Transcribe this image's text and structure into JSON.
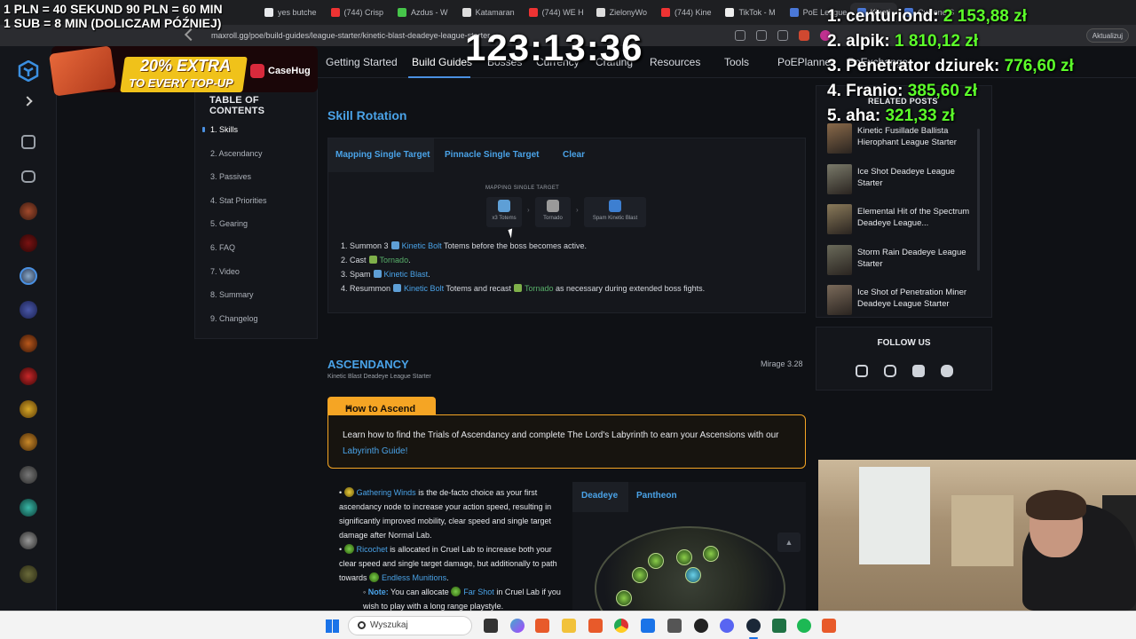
{
  "browser": {
    "tabs": [
      {
        "label": "yes butche",
        "color": "#e8eaed"
      },
      {
        "label": "(744) Crisp",
        "color": "#e33"
      },
      {
        "label": "Azdus - W",
        "color": "#46c54a"
      },
      {
        "label": "Katamaran",
        "color": "#ddd"
      },
      {
        "label": "(744) WE H",
        "color": "#e33"
      },
      {
        "label": "ZielonyWo",
        "color": "#ddd"
      },
      {
        "label": "(744) Kine",
        "color": "#e33"
      },
      {
        "label": "TikTok - M",
        "color": "#eee"
      },
      {
        "label": "PoE League",
        "color": "#4a78d8"
      },
      {
        "label": "Kineti",
        "color": "#4a78d8"
      },
      {
        "label": "Cyclone S",
        "color": "#4a78d8"
      }
    ],
    "url": "maxroll.gg/poe/build-guides/league-starter/kinetic-blast-deadeye-league-starter",
    "update_label": "Aktualizuj"
  },
  "nav": {
    "items": [
      "Getting Started",
      "Build Guides",
      "Bosses",
      "Currency",
      "Crafting",
      "Resources",
      "Tools",
      "PoEPlanner",
      "PoExchange"
    ],
    "active": "Build Guides"
  },
  "toc": {
    "title": "TABLE OF CONTENTS",
    "items": [
      "1. Skills",
      "2. Ascendancy",
      "3. Passives",
      "4. Stat Priorities",
      "5. Gearing",
      "6. FAQ",
      "7. Video",
      "8. Summary",
      "9. Changelog"
    ]
  },
  "skill_rotation": {
    "title": "Skill Rotation",
    "tabs": [
      "Mapping Single Target",
      "Pinnacle Single Target",
      "Clear"
    ],
    "sequence_label": "MAPPING SINGLE TARGET",
    "sequence": [
      {
        "caption": "x3 Totems",
        "icon": "kinetic-bolt-icon",
        "color": "#5e9fd6"
      },
      {
        "caption": "Tornado",
        "icon": "tornado-icon",
        "color": "#9a9a9a"
      },
      {
        "caption": "Spam Kinetic Blast",
        "icon": "kinetic-blast-icon",
        "color": "#3d7fd1"
      }
    ],
    "steps": [
      {
        "num": "1.",
        "pre": "Summon 3",
        "skill": "Kinetic Bolt",
        "post": "Totems before the boss becomes active."
      },
      {
        "num": "2.",
        "pre": "Cast",
        "skill": "Tornado",
        "post": "."
      },
      {
        "num": "3.",
        "pre": "Spam",
        "skill": "Kinetic Blast",
        "post": "."
      },
      {
        "num": "4.",
        "pre": "Resummon",
        "skill": "Kinetic Bolt",
        "mid": "Totems and recast",
        "skill2": "Tornado",
        "post": "as necessary during extended boss fights."
      }
    ]
  },
  "ascendancy": {
    "title": "ASCENDANCY",
    "subtitle": "Kinetic Blast Deadeye League Starter",
    "version": "Mirage 3.28",
    "howto_title": "How to Ascend",
    "howto_text_pre": "Learn how to find the Trials of Ascendancy and complete The Lord's Labyrinth to earn your Ascensions with our",
    "howto_link": "Labyrinth Guide!",
    "tree_tabs": [
      "Deadeye",
      "Pantheon"
    ],
    "bullets": [
      {
        "skill": "Gathering Winds",
        "text": "is the de-facto choice as your first ascendancy node to increase your action speed, resulting in significantly improved mobility, clear speed and single target damage after Normal Lab."
      },
      {
        "skill": "Ricochet",
        "text": "is allocated in Cruel Lab to increase both your clear speed and single target damage, but additionally to path towards",
        "skill2": "Endless Munitions",
        "post": "."
      },
      {
        "note": "Note:",
        "text": "You can allocate",
        "skill": "Far Shot",
        "post": "in Cruel Lab if you wish to play with a long range playstyle."
      }
    ]
  },
  "related": {
    "title": "RELATED POSTS",
    "items": [
      "Kinetic Fusillade Ballista Hierophant League Starter",
      "Ice Shot Deadeye League Starter",
      "Elemental Hit of the Spectrum Deadeye League...",
      "Storm Rain Deadeye League Starter",
      "Ice Shot of Penetration Miner Deadeye League Starter"
    ]
  },
  "follow": {
    "title": "FOLLOW US"
  },
  "stream": {
    "rules_line1": "1 PLN =  40 SEKUND 90 PLN = 60 MIN",
    "rules_line2": "1 SUB = 8 MIN (DOLICZAM PÓŹNIEJ)",
    "timer": "123:13:36",
    "promo_line1": "20% EXTRA",
    "promo_line2": "TO EVERY TOP-UP",
    "promo_brand": "CaseHug",
    "leaderboard": [
      {
        "rank": "1.",
        "name": "centuriond:",
        "amount": "2 153,88 zł"
      },
      {
        "rank": "2.",
        "name": "alpik:",
        "amount": "1 810,12 zł"
      },
      {
        "rank": "3.",
        "name": "Penetrator dziurek:",
        "amount": "776,60 zł"
      },
      {
        "rank": "4.",
        "name": "Franio:",
        "amount": "385,60 zł"
      },
      {
        "rank": "5.",
        "name": "aha:",
        "amount": "321,33 zł"
      }
    ]
  },
  "taskbar": {
    "search_placeholder": "Wyszukaj"
  }
}
